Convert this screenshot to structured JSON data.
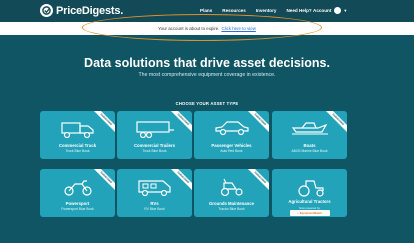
{
  "header": {
    "logo": "PriceDigests.",
    "nav": [
      "Plans",
      "Resources",
      "Inventory",
      "Need Help?"
    ],
    "account": "Account"
  },
  "alert": {
    "text": "Your account is about to expire.",
    "link": "Click here to view"
  },
  "hero": {
    "title": "Data solutions that drive asset decisions.",
    "subtitle": "The most comprehensive equipment coverage in existence."
  },
  "section_label": "CHOOSE YOUR ASSET TYPE",
  "cards": [
    {
      "title": "Commercial Truck",
      "subtitle": "Truck Blue Book",
      "ribbon": "Subscribed",
      "icon": "truck-icon"
    },
    {
      "title": "Commercial Trailers",
      "subtitle": "Truck Blue Book",
      "ribbon": "Subscribed",
      "icon": "trailer-icon"
    },
    {
      "title": "Passenger Vehicles",
      "subtitle": "Auto Red Book",
      "ribbon": "Subscribed",
      "icon": "car-icon"
    },
    {
      "title": "Boats",
      "subtitle": "ABOS Marine Blue Book",
      "ribbon": "Subscribed",
      "icon": "boat-icon"
    },
    {
      "title": "Powersport",
      "subtitle": "Powersport Blue Book",
      "ribbon": "Subscribed",
      "icon": "motorcycle-icon"
    },
    {
      "title": "RVs",
      "subtitle": "RV Blue Book",
      "ribbon": "Subscribed",
      "icon": "rv-icon"
    },
    {
      "title": "Grounds Maintenance",
      "subtitle": "Tractor Blue Book",
      "ribbon": "Subscribed",
      "icon": "mower-icon"
    },
    {
      "title": "Agricultural Tractors",
      "subtitle": "Now powered by",
      "powered": "EquipmentWatch",
      "icon": "tractor-icon"
    }
  ],
  "colors": {
    "background": "#0f5564",
    "card": "#22a3ba",
    "alert_highlight": "#e0902a",
    "link": "#2a6fd1"
  }
}
